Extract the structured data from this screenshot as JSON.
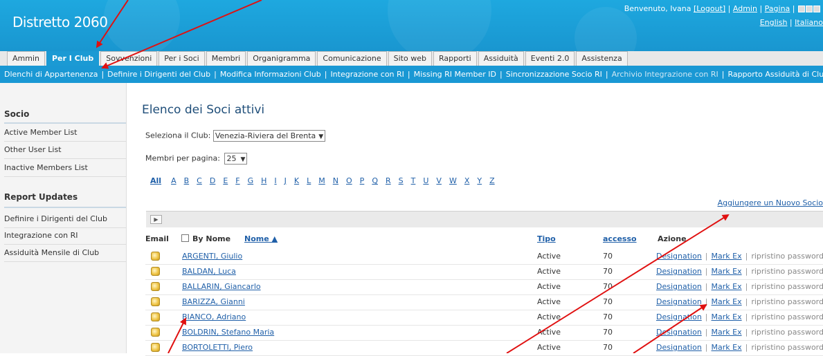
{
  "header": {
    "logo": "Distretto 2060",
    "welcome_prefix": "Benvenuto, Ivana ",
    "logout": "[Logout]",
    "admin": "Admin",
    "pagina": "Pagina",
    "sep": " | ",
    "lang_english": "English",
    "lang_italiano": "Italiano",
    "font_sizes": [
      "A",
      "A",
      "A"
    ]
  },
  "tabs": [
    "Ammin",
    "Per I Club",
    "Sovvenzioni",
    "Per i Soci",
    "Membri",
    "Organigramma",
    "Comunicazione",
    "Sito web",
    "Rapporti",
    "Assiduità",
    "Eventi 2.0",
    "Assistenza"
  ],
  "active_tab": "Per I Club",
  "subnav": [
    "Dlenchi di Appartenenza",
    "Definire i Dirigenti del Club",
    "Modifica Informazioni Club",
    "Integrazione con RI",
    "Missing RI Member ID",
    "Sincronizzazione Socio RI",
    "Archivio Integrazione con RI",
    "Rapporto Assiduità di Club"
  ],
  "sidebar": {
    "section1": "Socio",
    "items1": [
      "Active Member List",
      "Other User List",
      "Inactive Members List"
    ],
    "section2": "Report Updates",
    "items2": [
      "Definire i Dirigenti del Club",
      "Integrazione con RI",
      "Assiduità Mensile di Club"
    ]
  },
  "main": {
    "title": "Elenco dei Soci attivi",
    "club_label": "Seleziona il Club:",
    "club_value": "Venezia-Riviera del Brenta",
    "per_page_label": "Membri per pagina:",
    "per_page_value": "25",
    "letters_all": "All",
    "letters": [
      "A",
      "B",
      "C",
      "D",
      "E",
      "F",
      "G",
      "H",
      "I",
      "J",
      "K",
      "L",
      "M",
      "N",
      "O",
      "P",
      "Q",
      "R",
      "S",
      "T",
      "U",
      "V",
      "W",
      "X",
      "Y",
      "Z"
    ],
    "add_link": "Aggiungere un Nuovo Socio",
    "columns": {
      "email": "Email",
      "by_name": "By Nome",
      "name": "Nome ▲",
      "type": "Tipo",
      "access": "accesso",
      "action": "Azione"
    },
    "action_labels": {
      "designation": "Designation",
      "mark_ex": "Mark Ex",
      "reset": "ripristino password"
    },
    "rows": [
      {
        "name": "ARGENTI, Giulio",
        "type": "Active",
        "access": "70"
      },
      {
        "name": "BALDAN, Luca",
        "type": "Active",
        "access": "70"
      },
      {
        "name": "BALLARIN, Giancarlo",
        "type": "Active",
        "access": "70"
      },
      {
        "name": "BARIZZA, Gianni",
        "type": "Active",
        "access": "70"
      },
      {
        "name": "BIANCO, Adriano",
        "type": "Active",
        "access": "70"
      },
      {
        "name": "BOLDRIN, Stefano Maria",
        "type": "Active",
        "access": "70"
      },
      {
        "name": "BORTOLETTI, Piero",
        "type": "Active",
        "access": "70"
      }
    ]
  },
  "colors": {
    "header_blue": "#1ea8df",
    "tab_active": "#1b9ad4",
    "link": "#1f5fa8",
    "annotation_red": "#e01010"
  }
}
